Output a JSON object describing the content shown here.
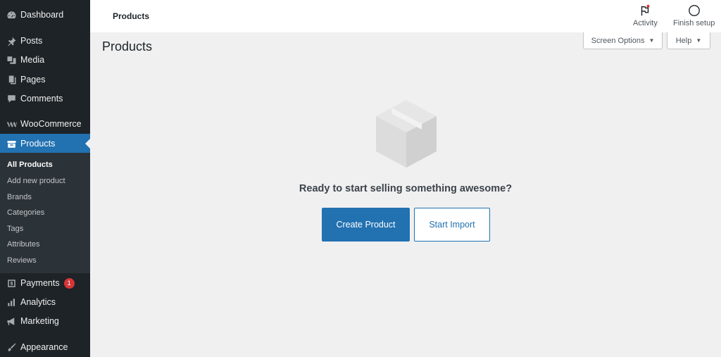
{
  "sidebar": {
    "items": [
      {
        "label": "Dashboard",
        "icon": "dashboard-icon"
      },
      {
        "label": "Posts",
        "icon": "pin-icon"
      },
      {
        "label": "Media",
        "icon": "media-icon"
      },
      {
        "label": "Pages",
        "icon": "pages-icon"
      },
      {
        "label": "Comments",
        "icon": "comment-icon"
      },
      {
        "label": "WooCommerce",
        "icon": "woocommerce-icon"
      },
      {
        "label": "Products",
        "icon": "archive-icon"
      },
      {
        "label": "Payments",
        "icon": "payments-icon",
        "badge": "1"
      },
      {
        "label": "Analytics",
        "icon": "bar-chart-icon"
      },
      {
        "label": "Marketing",
        "icon": "megaphone-icon"
      },
      {
        "label": "Appearance",
        "icon": "brush-icon"
      }
    ],
    "submenu": [
      "All Products",
      "Add new product",
      "Brands",
      "Categories",
      "Tags",
      "Attributes",
      "Reviews"
    ]
  },
  "topbar": {
    "title": "Products",
    "activity_label": "Activity",
    "finish_setup_label": "Finish setup"
  },
  "screen_options_label": "Screen Options",
  "help_label": "Help",
  "page_title": "Products",
  "empty_state": {
    "message": "Ready to start selling something awesome?",
    "create_label": "Create Product",
    "import_label": "Start Import"
  },
  "colors": {
    "sidebar": "#1d2327",
    "active": "#2271b1",
    "badge": "#d63638"
  }
}
